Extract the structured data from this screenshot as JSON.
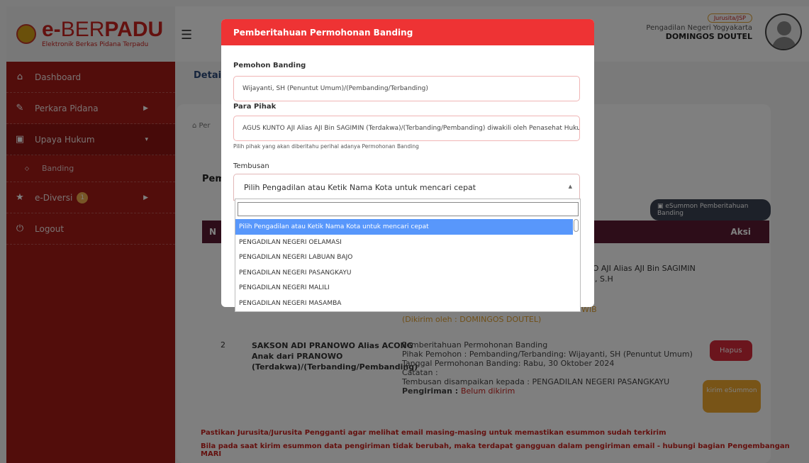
{
  "app": {
    "logo_main_e": "e-",
    "logo_main_ber": "BER",
    "logo_main_padu": "PADU",
    "logo_sub": "Elektronik Berkas Pidana Terpadu"
  },
  "sidebar": {
    "items": [
      {
        "label": "Dashboard",
        "icon": "home-icon"
      },
      {
        "label": "Perkara Pidana",
        "icon": "edit-icon"
      },
      {
        "label": "Upaya Hukum",
        "icon": "book-icon"
      },
      {
        "label": "Banding",
        "icon": "circle-icon"
      },
      {
        "label": "e-Diversi",
        "icon": "star-icon",
        "badge": "1"
      },
      {
        "label": "Logout",
        "icon": "power-icon"
      }
    ]
  },
  "header": {
    "role": "Jurusita/JSP",
    "court": "Pengadilan Negeri Yogyakarta",
    "user": "DOMINGOS DOUTEL"
  },
  "main": {
    "title": "Detail",
    "breadcrumb_icon_text": "Per",
    "section_title": "Peml",
    "esummon_button": "eSummon Pemberitahuan Banding",
    "col_aksi": "Aksi",
    "col_no": "N",
    "row1_line1": "TO AJI Alias AJI Bin SAGIMIN",
    "row1_line2": "di, S.H",
    "row1_wib": "WIB",
    "row1_sent": "(Dikirim oleh : DOMINGOS DOUTEL)",
    "row2": {
      "no": "2",
      "party": "SAKSON ADI PRANOWO Alias ACONG Anak dari PRANOWO (Terdakwa)/(Terbanding/Pembanding)",
      "title": "Pemberitahuan Permohonan Banding",
      "pemohon": "Pihak Pemohon : Pembanding/Terbanding: Wijayanti, SH (Penuntut Umum)",
      "tanggal": "Tanggal Permohonan Banding: Rabu, 30 Oktober 2024",
      "catatan": "Catatan :",
      "tembusan": "Tembusan disampaikan kepada : PENGADILAN NEGERI PASANGKAYU",
      "pengiriman_label": "Pengiriman :",
      "pengiriman_value": "Belum dikirim",
      "hapus": "Hapus",
      "kirim": "kirim eSummon"
    },
    "warning1": "Pastikan Jurusita/Jurusita Pengganti agar melihat email masing-masing untuk memastikan esummon sudah terkirim",
    "warning2": "Bila pada saat kirim esummon data pengiriman tidak berubah, maka terdapat gangguan dalam pengiriman email - hubungi bagian Pengembangan MARI"
  },
  "modal": {
    "title": "Pemberitahuan Permohonan Banding",
    "pemohon_label": "Pemohon Banding",
    "pemohon_value": "Wijayanti, SH (Penuntut Umum)/(Pembanding/Terbanding)",
    "para_pihak_label": "Para Pihak",
    "para_pihak_value": "AGUS KUNTO AJI Alias AJI Bin SAGIMIN (Terdakwa)/(Terbanding/Pembanding) diwakili oleh Penasehat Hukum",
    "hint": "Pilih pihak yang akan diberitahu perihal adanya Permohonan Banding",
    "tembusan_label": "Tembusan",
    "select_placeholder": "Pilih Pengadilan atau Ketik Nama Kota untuk mencari cepat",
    "options": [
      "Pilih Pengadilan atau Ketik Nama Kota untuk mencari cepat",
      "PENGADILAN NEGERI OELAMASI",
      "PENGADILAN NEGERI LABUAN BAJO",
      "PENGADILAN NEGERI PASANGKAYU",
      "PENGADILAN NEGERI MALILI",
      "PENGADILAN NEGERI MASAMBA"
    ]
  }
}
